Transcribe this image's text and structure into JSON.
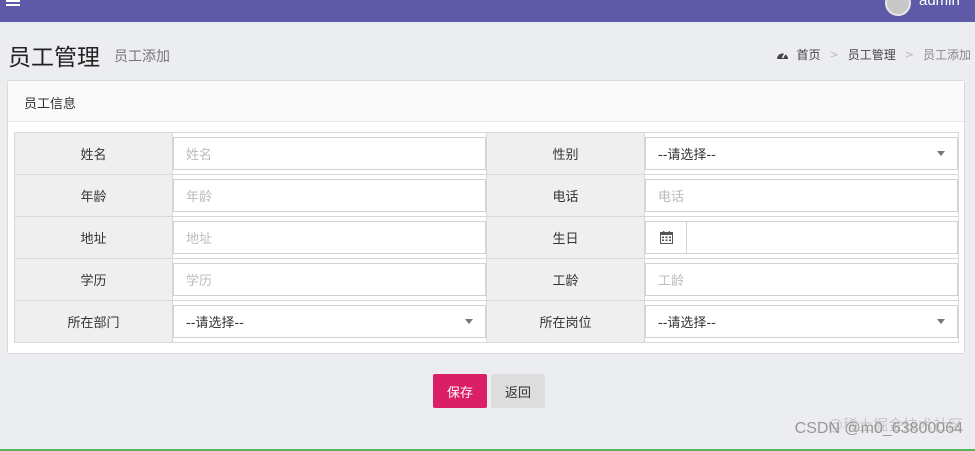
{
  "topbar": {
    "username": "admin",
    "accent": "#5e5aa8"
  },
  "header": {
    "title": "员工管理",
    "subtitle": "员工添加"
  },
  "breadcrumb": {
    "icon": "dashboard-icon",
    "home": "首页",
    "section": "员工管理",
    "current": "员工添加",
    "separator": ">"
  },
  "panel": {
    "title": "员工信息"
  },
  "form": {
    "name": {
      "label": "姓名",
      "placeholder": "姓名"
    },
    "gender": {
      "label": "性别",
      "selected": "--请选择--"
    },
    "age": {
      "label": "年龄",
      "placeholder": "年龄"
    },
    "phone": {
      "label": "电话",
      "placeholder": "电话"
    },
    "address": {
      "label": "地址",
      "placeholder": "地址"
    },
    "birthday": {
      "label": "生日",
      "icon": "calendar-icon"
    },
    "education": {
      "label": "学历",
      "placeholder": "学历"
    },
    "seniority": {
      "label": "工龄",
      "placeholder": "工龄"
    },
    "department": {
      "label": "所在部门",
      "selected": "--请选择--"
    },
    "position": {
      "label": "所在岗位",
      "selected": "--请选择--"
    }
  },
  "buttons": {
    "save": "保存",
    "back": "返回",
    "save_color": "#db1f66"
  },
  "watermark": {
    "top": "@稀土掘金技术社区",
    "bottom": "CSDN @m0_63800064"
  }
}
